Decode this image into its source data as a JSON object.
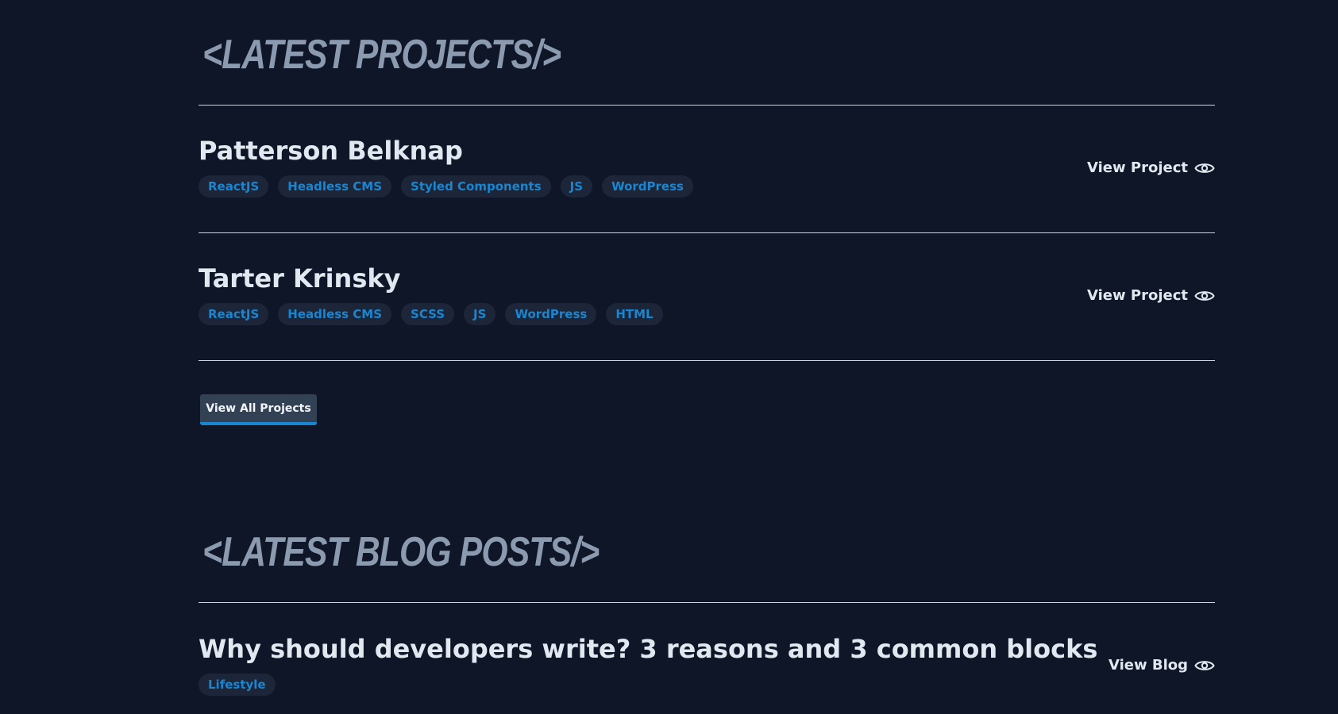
{
  "projects_section": {
    "title": "<LATEST PROJECTS/>",
    "items": [
      {
        "title": "Patterson Belknap",
        "tags": [
          "ReactJS",
          "Headless CMS",
          "Styled Components",
          "JS",
          "WordPress"
        ],
        "link_label": "View Project"
      },
      {
        "title": "Tarter Krinsky",
        "tags": [
          "ReactJS",
          "Headless CMS",
          "SCSS",
          "JS",
          "WordPress",
          "HTML"
        ],
        "link_label": "View Project"
      }
    ],
    "view_all_label": "View All Projects"
  },
  "blog_section": {
    "title": "<LATEST BLOG POSTS/>",
    "items": [
      {
        "title": "Why should developers write? 3 reasons and 3 common blocks",
        "tags": [
          "Lifestyle"
        ],
        "link_label": "View Blog"
      }
    ]
  },
  "colors": {
    "background": "#0e1628",
    "heading": "#8c9ab0",
    "text": "#e2e8f0",
    "tag_bg": "#1c2638",
    "tag_text": "#1a85d0",
    "button_bg": "#334155",
    "accent": "#1a85d0"
  },
  "icons": {
    "view": "eye-icon"
  }
}
